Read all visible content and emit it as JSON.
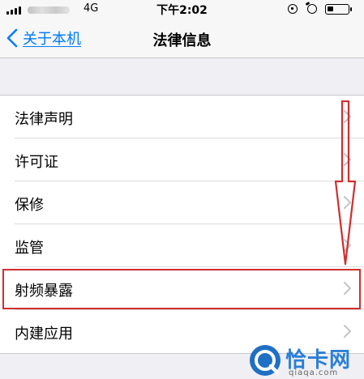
{
  "status_bar": {
    "network": "4G",
    "time": "下午2:02"
  },
  "nav_bar": {
    "back_label": "关于本机",
    "title": "法律信息"
  },
  "list": {
    "items": [
      {
        "label": "法律声明"
      },
      {
        "label": "许可证"
      },
      {
        "label": "保修"
      },
      {
        "label": "监管"
      },
      {
        "label": "射频暴露"
      },
      {
        "label": "内建应用"
      }
    ]
  },
  "annotations": {
    "highlighted_item": "射频暴露",
    "highlight_color": "#d12d2d"
  },
  "watermark": {
    "name": "恰卡网",
    "url": "qiaqa.com"
  },
  "colors": {
    "accent": "#007aff",
    "background": "#efeff4"
  },
  "icons": [
    "signal-icon",
    "rotation-lock-icon",
    "alarm-icon",
    "battery-icon",
    "chevron-left-icon",
    "chevron-right-icon"
  ]
}
